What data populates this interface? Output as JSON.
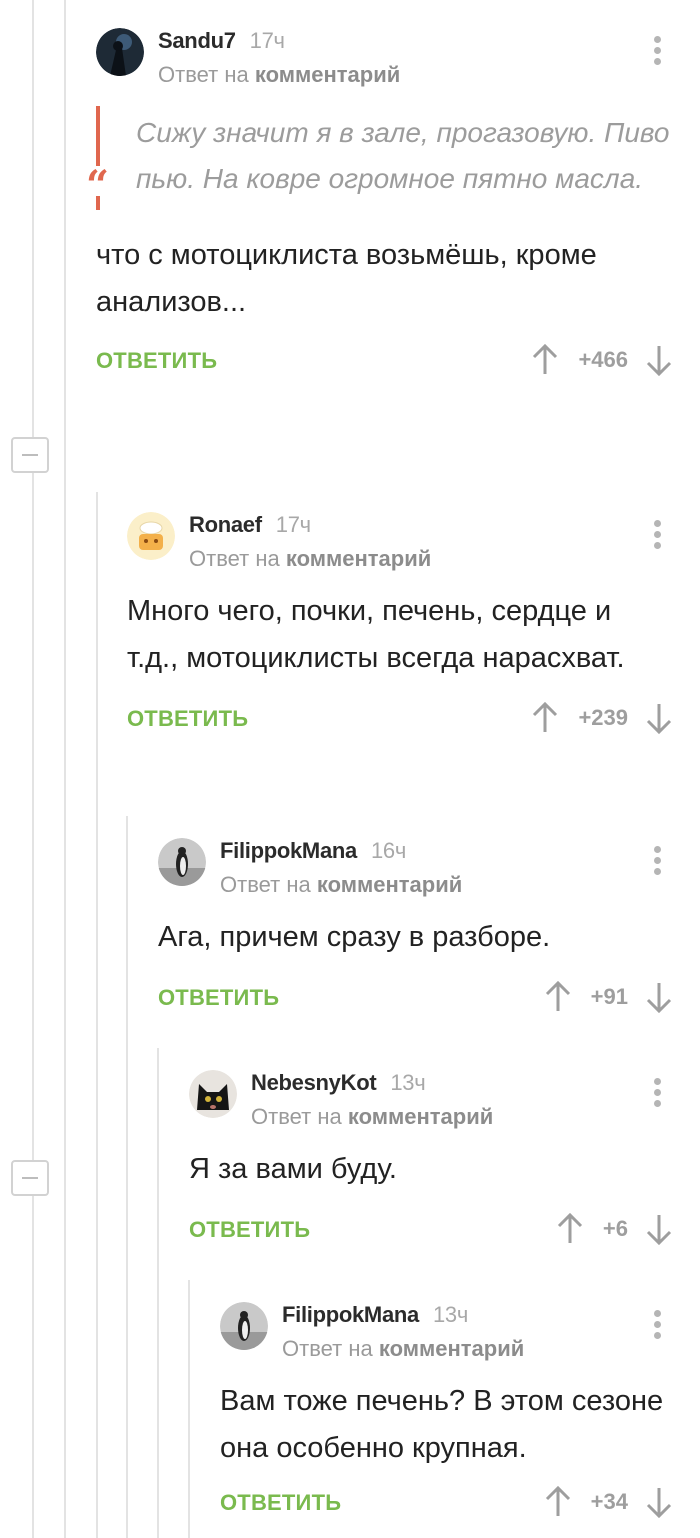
{
  "comments": [
    {
      "author": "Sandu7",
      "time": "17ч",
      "reply_prefix": "Ответ на",
      "reply_link": "комментарий",
      "quote": "Сижу значит я в зале, прогазовую. Пиво пью. На ковре огромное пятно масла.",
      "text": "что с мотоциклиста возьмёшь, кроме анализов...",
      "reply_label": "ОТВЕТИТЬ",
      "score": "+466",
      "avatar_icon": "dark-figure-avatar"
    },
    {
      "author": "Ronaef",
      "time": "17ч",
      "reply_prefix": "Ответ на",
      "reply_link": "комментарий",
      "text": "Много чего, почки, печень, сердце и т.д., мотоциклисты всегда нарасхват.",
      "reply_label": "ОТВЕТИТЬ",
      "score": "+239",
      "avatar_icon": "cartoon-avatar"
    },
    {
      "author": "FilippokMana",
      "time": "16ч",
      "reply_prefix": "Ответ на",
      "reply_link": "комментарий",
      "text": "Ага, причем сразу в разборе.",
      "reply_label": "ОТВЕТИТЬ",
      "score": "+91",
      "avatar_icon": "penguin-avatar"
    },
    {
      "author": "NebesnyKot",
      "time": "13ч",
      "reply_prefix": "Ответ на",
      "reply_link": "комментарий",
      "text": "Я за вами буду.",
      "reply_label": "ОТВЕТИТЬ",
      "score": "+6",
      "avatar_icon": "black-cat-avatar"
    },
    {
      "author": "FilippokMana",
      "time": "13ч",
      "reply_prefix": "Ответ на",
      "reply_link": "комментарий",
      "text": "Вам тоже печень? В этом сезоне она особенно крупная.",
      "reply_label": "ОТВЕТИТЬ",
      "score": "+34",
      "avatar_icon": "penguin-avatar"
    }
  ],
  "colors": {
    "reply_green": "#7aba4e",
    "quote_accent": "#e0674e",
    "thread_line": "#e3e3e3",
    "muted_text": "#9a9a9a"
  }
}
